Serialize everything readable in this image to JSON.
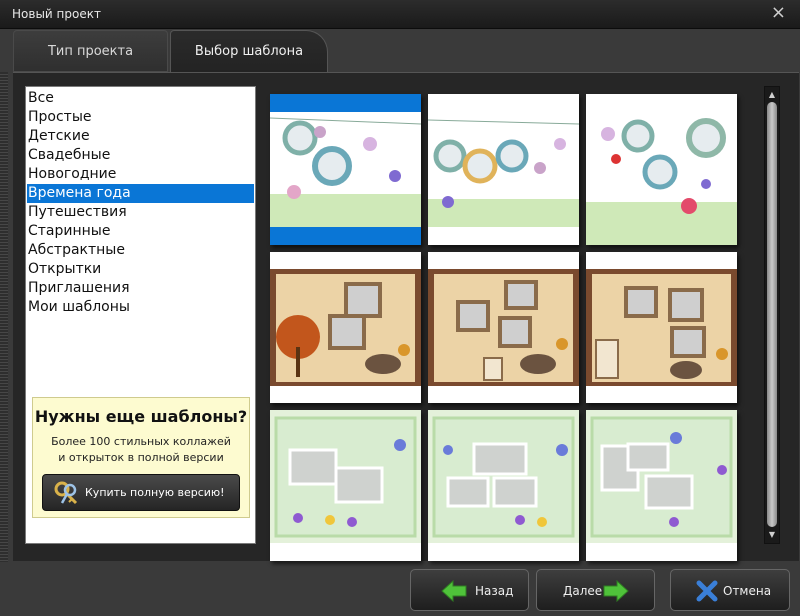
{
  "window": {
    "title": "Новый проект",
    "close_glyph": "×"
  },
  "tabs": [
    {
      "label": "Тип проекта",
      "active": false
    },
    {
      "label": "Выбор шаблона",
      "active": true
    }
  ],
  "categories": {
    "items": [
      "Все",
      "Простые",
      "Детские",
      "Свадебные",
      "Новогодние",
      "Времена года",
      "Путешествия",
      "Старинные",
      "Абстрактные",
      "Открытки",
      "Приглашения",
      "Мои шаблоны"
    ],
    "selected": "Времена года"
  },
  "promo": {
    "title": "Нужны еще шаблоны?",
    "line1": "Более 100 стильных коллажей",
    "line2": "и открыток в полной версии",
    "button_label": "Купить полную версию!",
    "button_icon": "key-icon"
  },
  "templates": {
    "rows": [
      {
        "theme": "spring-frames",
        "count": 3
      },
      {
        "theme": "autumn-photos",
        "count": 3
      },
      {
        "theme": "spring-flowers",
        "count": 3
      }
    ],
    "selected_index": 0
  },
  "buttons": {
    "back": {
      "label": "Назад",
      "icon": "arrow-left-icon"
    },
    "next": {
      "label": "Далее",
      "icon": "arrow-right-icon"
    },
    "cancel": {
      "label": "Отмена",
      "icon": "close-icon"
    }
  },
  "colors": {
    "selection": "#0a76d6",
    "promo_background": "#fdfbd0",
    "arrow_green": "#4fc23a",
    "cancel_blue": "#3a7fd8"
  }
}
